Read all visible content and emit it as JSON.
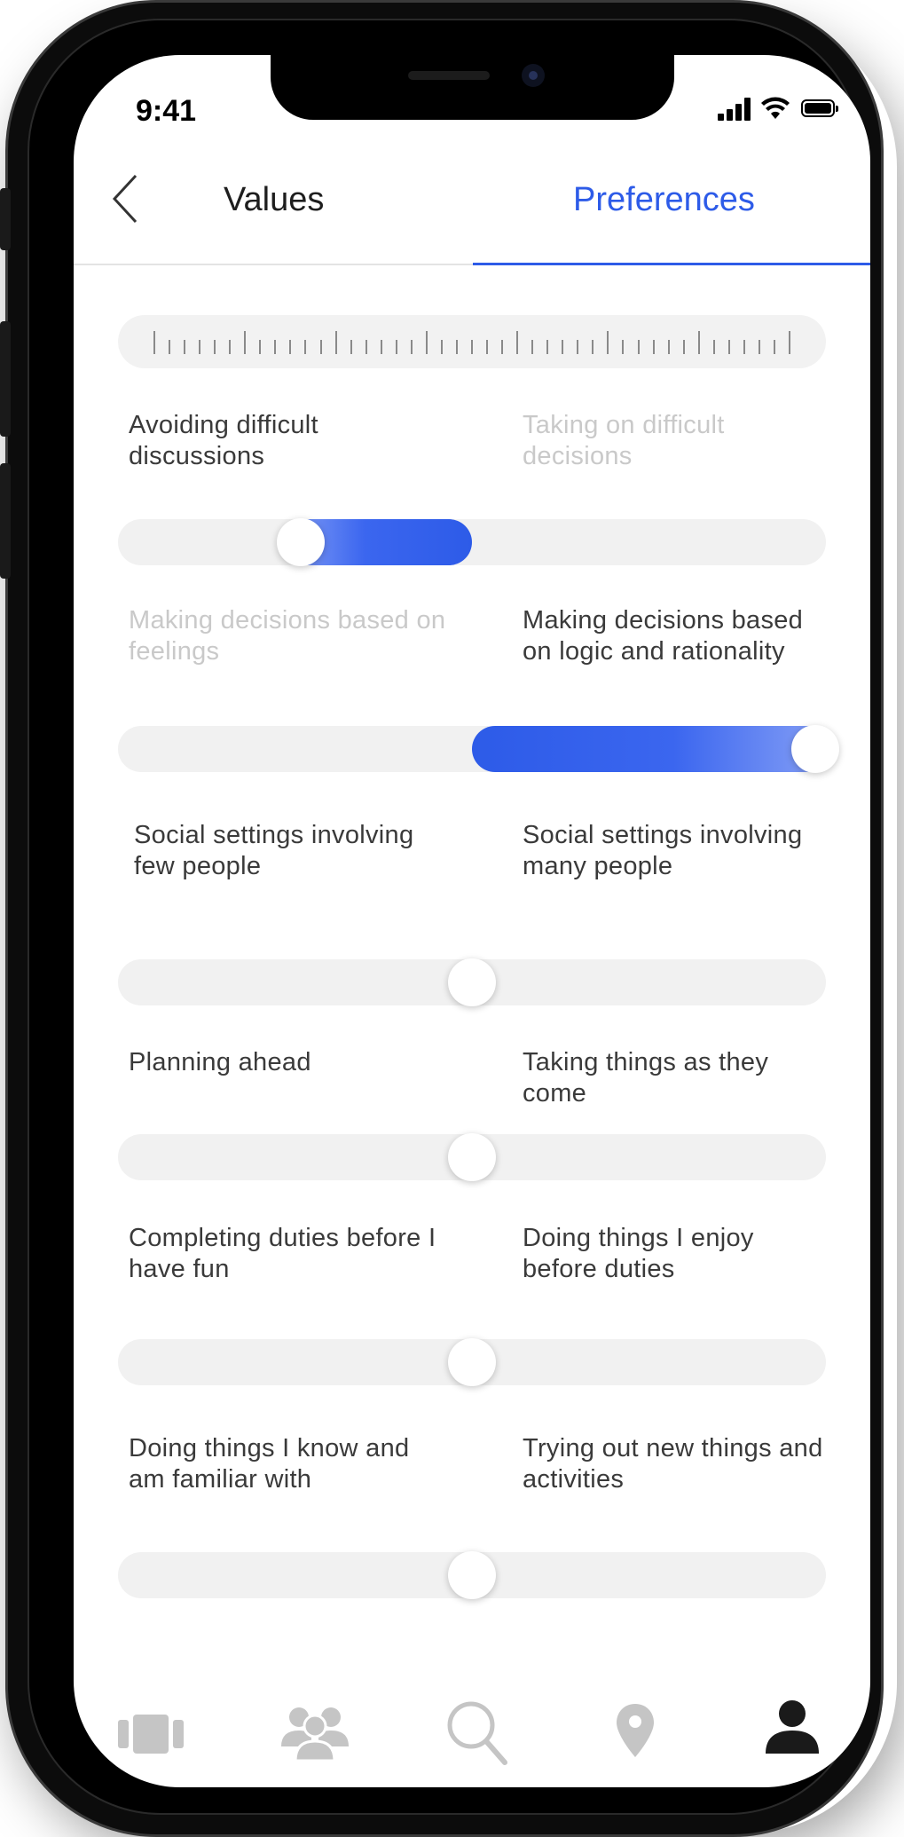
{
  "status_bar": {
    "time": "9:41"
  },
  "header": {
    "back_icon": "chevron-left-icon",
    "tab_values": "Values",
    "tab_preferences": "Preferences",
    "active_tab": "Preferences",
    "accent_color": "#2d5be8"
  },
  "preferences": [
    {
      "left": "Avoiding difficult discussions",
      "right": "Taking on difficult decisions",
      "value": -0.5
    },
    {
      "left": "Making decisions based on feelings",
      "right": "Making decisions based on logic and rationality",
      "value": 1.0
    },
    {
      "left": "Social settings involving few people",
      "right": "Social settings involving many people",
      "value": 0
    },
    {
      "left": "Planning ahead",
      "right": "Taking things as they come",
      "value": 0
    },
    {
      "left": "Completing duties before I have fun",
      "right": "Doing things I enjoy before duties",
      "value": 0
    },
    {
      "left": "Doing things I know and am familiar with",
      "right": "Trying out new things and activities",
      "value": 0
    }
  ],
  "tab_bar": {
    "items": [
      "cards-icon",
      "people-icon",
      "search-icon",
      "location-pin-icon",
      "profile-icon"
    ],
    "active": "profile-icon"
  }
}
